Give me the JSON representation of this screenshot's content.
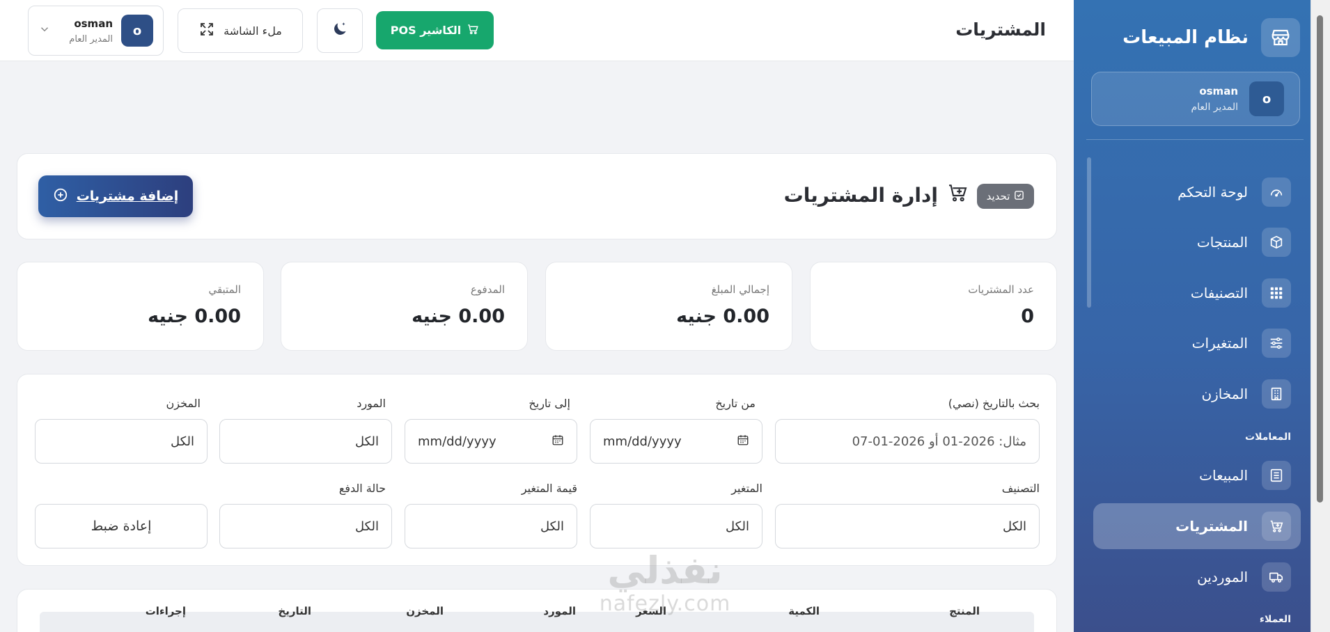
{
  "sidebar": {
    "brand_title": "نظام المبيعات",
    "user": {
      "avatar_letter": "o",
      "name": "osman",
      "role": "المدير العام"
    },
    "nav": [
      {
        "label": "لوحة التحكم",
        "icon": "dashboard-gauge-icon"
      },
      {
        "label": "المنتجات",
        "icon": "box-icon"
      },
      {
        "label": "التصنيفات",
        "icon": "grid-icon"
      },
      {
        "label": "المتغيرات",
        "icon": "sliders-icon"
      },
      {
        "label": "المخازن",
        "icon": "building-icon"
      }
    ],
    "section_transactions": "المعاملات",
    "nav2": [
      {
        "label": "المبيعات",
        "icon": "receipt-icon"
      },
      {
        "label": "المشتريات",
        "icon": "cart-plus-icon",
        "active": true
      },
      {
        "label": "الموردين",
        "icon": "truck-icon"
      }
    ],
    "section_customers": "العملاء"
  },
  "topbar": {
    "page_title": "المشتريات",
    "pos_label": "الكاشير POS",
    "fullscreen_label": "ملء الشاشة",
    "user": {
      "avatar_letter": "o",
      "name": "osman",
      "role": "المدير العام"
    }
  },
  "header": {
    "refresh_label": "تحديد",
    "title": "إدارة المشتريات",
    "add_label": "إضافة مشتريات"
  },
  "stats": [
    {
      "label": "عدد المشتريات",
      "value": "0"
    },
    {
      "label": "إجمالي المبلغ",
      "value": "0.00 جنيه"
    },
    {
      "label": "المدفوع",
      "value": "0.00 جنيه"
    },
    {
      "label": "المتبقي",
      "value": "0.00 جنيه"
    }
  ],
  "filters": {
    "text_date": {
      "label": "بحث بالتاريخ (نصي)",
      "placeholder": "مثال: 2026-01 أو 2026-01-07"
    },
    "from_date": {
      "label": "من تاريخ",
      "value": "mm/dd/yyyy"
    },
    "to_date": {
      "label": "إلى تاريخ",
      "value": "mm/dd/yyyy"
    },
    "supplier": {
      "label": "المورد",
      "value": "الكل"
    },
    "warehouse": {
      "label": "المخزن",
      "value": "الكل"
    },
    "category": {
      "label": "التصنيف",
      "value": "الكل"
    },
    "variant": {
      "label": "المتغير",
      "value": "الكل"
    },
    "variant_value": {
      "label": "قيمة المتغير",
      "value": "الكل"
    },
    "payment_status": {
      "label": "حالة الدفع",
      "value": "الكل"
    },
    "reset_label": "إعادة ضبط"
  },
  "table": {
    "headers": [
      "المنتج",
      "الكمية",
      "السعر",
      "المورد",
      "المخزن",
      "التاريخ",
      "إجراءات"
    ]
  },
  "watermark": {
    "arabic": "نفذلي",
    "latin": "nafezly.com"
  },
  "colors": {
    "sidebar_top": "#3472b3",
    "sidebar_bottom": "#3b4f8c",
    "pos_green": "#17a76d",
    "add_button": "#2f5fa5",
    "page_bg": "#f2f3f6"
  }
}
